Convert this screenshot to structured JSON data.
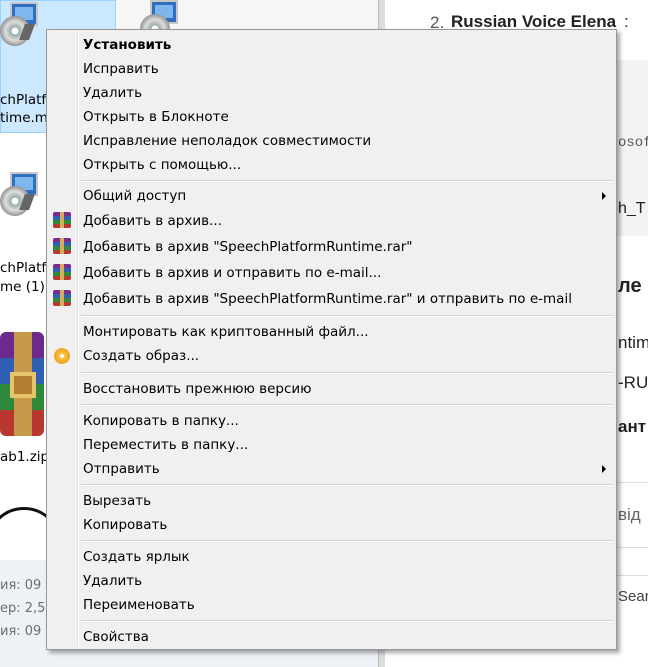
{
  "explorer": {
    "files": [
      {
        "name_line1": "chPlatf",
        "name_line2": "time.m"
      },
      {
        "name_line1": "chPlatfo",
        "name_line2": "me (1)."
      },
      {
        "name_line1": "ab1.zip"
      }
    ],
    "meta": [
      {
        "text": "ия:  09"
      },
      {
        "text": "ер:  2,5"
      },
      {
        "text": "ия:  09"
      }
    ]
  },
  "document": {
    "heading_number": "2.",
    "heading_text": "Russian Voice Elena",
    "heading_colon": ":",
    "code_frag": "osof",
    "line_frags": [
      "h_T",
      "ле",
      "ntim",
      "-RU",
      "ант",
      "від",
      "Searc"
    ]
  },
  "context_menu": {
    "groups": [
      [
        "Установить",
        "Исправить",
        "Удалить",
        "Открыть в Блокноте",
        "Исправление неполадок совместимости",
        "Открыть с помощью..."
      ],
      [
        "Общий доступ",
        "Добавить в архив...",
        "Добавить в архив \"SpeechPlatformRuntime.rar\"",
        "Добавить в архив и отправить по e-mail...",
        "Добавить в архив \"SpeechPlatformRuntime.rar\" и отправить по e-mail"
      ],
      [
        "Монтировать как криптованный файл...",
        "Создать образ..."
      ],
      [
        "Восстановить прежнюю версию"
      ],
      [
        "Копировать в папку...",
        "Переместить в папку...",
        "Отправить"
      ],
      [
        "Вырезать",
        "Копировать"
      ],
      [
        "Создать ярлык",
        "Удалить",
        "Переименовать"
      ],
      [
        "Свойства"
      ]
    ]
  },
  "icons": {
    "submenu_arrow": "chevron-right-icon",
    "archive": "winrar-icon",
    "disc": "disc-image-icon"
  }
}
